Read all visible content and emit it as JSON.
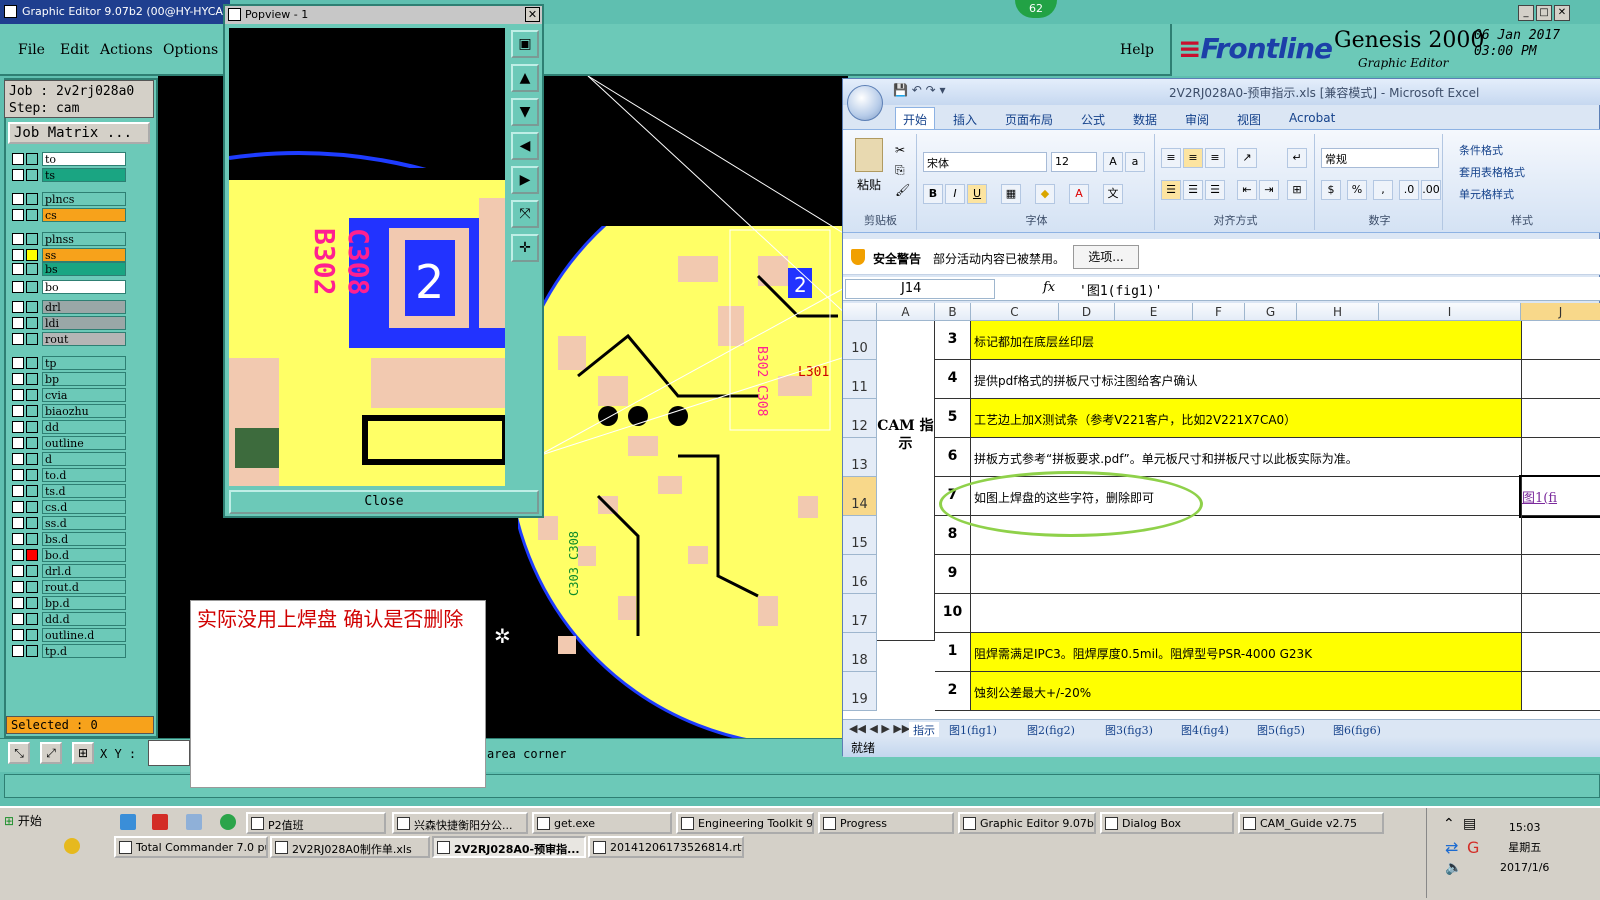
{
  "genesis": {
    "title": "Graphic Editor 9.07b2 (00@HY-HYCA",
    "menu": [
      "File",
      "Edit",
      "Actions",
      "Options"
    ],
    "help": "Help",
    "brand": {
      "logo": "Frontline",
      "product": "Genesis 2000",
      "subtitle": "Graphic Editor",
      "date": "06 Jan 2017",
      "time": "03:00 PM"
    },
    "badge": "62",
    "job": "Job : 2v2rj028a0",
    "step": "Step: cam",
    "job_matrix": "Job Matrix ...",
    "selected": "Selected : 0",
    "xy_label": "X Y :",
    "area_corner": "area corner",
    "layers": [
      {
        "name": "to",
        "color": "#ffffff",
        "swatch": ""
      },
      {
        "name": "ts",
        "color": "#1aa582",
        "swatch": ""
      },
      {
        "name": "plncs",
        "color": "#6cc9b8",
        "swatch": ""
      },
      {
        "name": "cs",
        "color": "#f7a21b",
        "swatch": ""
      },
      {
        "name": "plnss",
        "color": "#6cc9b8",
        "swatch": ""
      },
      {
        "name": "ss",
        "color": "#f7a21b",
        "swatch": "#ffff00"
      },
      {
        "name": "bs",
        "color": "#1aa582",
        "swatch": ""
      },
      {
        "name": "bo",
        "color": "#ffffff",
        "swatch": ""
      },
      {
        "name": "drl",
        "color": "#9aa7a7",
        "swatch": ""
      },
      {
        "name": "ldi",
        "color": "#9aa7a7",
        "swatch": ""
      },
      {
        "name": "rout",
        "color": "#b5b5b5",
        "swatch": ""
      },
      {
        "name": "tp",
        "color": "#6cc9b8",
        "swatch": ""
      },
      {
        "name": "bp",
        "color": "#6cc9b8",
        "swatch": ""
      },
      {
        "name": "cvia",
        "color": "#6cc9b8",
        "swatch": ""
      },
      {
        "name": "biaozhu",
        "color": "#6cc9b8",
        "swatch": ""
      },
      {
        "name": "dd",
        "color": "#6cc9b8",
        "swatch": ""
      },
      {
        "name": "outline",
        "color": "#6cc9b8",
        "swatch": ""
      },
      {
        "name": "d",
        "color": "#6cc9b8",
        "swatch": ""
      },
      {
        "name": "to.d",
        "color": "#6cc9b8",
        "swatch": ""
      },
      {
        "name": "ts.d",
        "color": "#6cc9b8",
        "swatch": ""
      },
      {
        "name": "cs.d",
        "color": "#6cc9b8",
        "swatch": ""
      },
      {
        "name": "ss.d",
        "color": "#6cc9b8",
        "swatch": ""
      },
      {
        "name": "bs.d",
        "color": "#6cc9b8",
        "swatch": ""
      },
      {
        "name": "bo.d",
        "color": "#6cc9b8",
        "swatch": "#ff0000"
      },
      {
        "name": "drl.d",
        "color": "#6cc9b8",
        "swatch": ""
      },
      {
        "name": "rout.d",
        "color": "#6cc9b8",
        "swatch": ""
      },
      {
        "name": "bp.d",
        "color": "#6cc9b8",
        "swatch": ""
      },
      {
        "name": "dd.d",
        "color": "#6cc9b8",
        "swatch": ""
      },
      {
        "name": "outline.d",
        "color": "#6cc9b8",
        "swatch": ""
      },
      {
        "name": "tp.d",
        "color": "#6cc9b8",
        "swatch": ""
      }
    ]
  },
  "popview": {
    "title": "Popview - 1",
    "close_label": "Close",
    "pcb_text": "2"
  },
  "note": {
    "text": "实际没用上焊盘  确认是否删除"
  },
  "excel": {
    "title": "2V2RJ028A0-预审指示.xls [兼容模式] - Microsoft Excel",
    "tabs": [
      "开始",
      "插入",
      "页面布局",
      "公式",
      "数据",
      "审阅",
      "视图",
      "Acrobat"
    ],
    "ribbon": {
      "paste": "粘贴",
      "clipboard": "剪贴板",
      "font_name": "宋体",
      "font_size": "12",
      "font_group": "字体",
      "align_group": "对齐方式",
      "number_format": "常规",
      "number_group": "数字",
      "styles_group": "样式",
      "cond_format": "条件格式",
      "table_format": "套用表格格式",
      "cell_style": "单元格样式"
    },
    "security": {
      "title": "安全警告",
      "message": "部分活动内容已被禁用。",
      "button": "选项..."
    },
    "name_box": "J14",
    "formula": "'图1(fig1)'",
    "columns": [
      "A",
      "B",
      "C",
      "D",
      "E",
      "F",
      "G",
      "H",
      "I",
      "J"
    ],
    "cam_label": "CAM 指示",
    "rows": [
      {
        "row": "10",
        "num": "3",
        "text": "标记都加在底层丝印层",
        "yellow": true,
        "link": ""
      },
      {
        "row": "11",
        "num": "4",
        "text": "提供pdf格式的拼板尺寸标注图给客户确认",
        "yellow": false,
        "link": ""
      },
      {
        "row": "12",
        "num": "5",
        "text": "工艺边上加X测试条（参考V221客户，比如2V221X7CA0）",
        "yellow": true,
        "link": ""
      },
      {
        "row": "13",
        "num": "6",
        "text": "拼板方式参考“拼板要求.pdf”。单元板尺寸和拼板尺寸以此板实际为准。",
        "yellow": false,
        "link": ""
      },
      {
        "row": "14",
        "num": "7",
        "text": "如图上焊盘的这些字符，删除即可",
        "yellow": false,
        "link": "图1(fi"
      },
      {
        "row": "15",
        "num": "8",
        "text": "",
        "yellow": false,
        "link": ""
      },
      {
        "row": "16",
        "num": "9",
        "text": "",
        "yellow": false,
        "link": ""
      },
      {
        "row": "17",
        "num": "10",
        "text": "",
        "yellow": false,
        "link": ""
      },
      {
        "row": "18",
        "num": "1",
        "text": "阻焊需满足IPC3。阻焊厚度0.5mil。阻焊型号PSR-4000 G23K",
        "yellow": true,
        "link": ""
      },
      {
        "row": "19",
        "num": "2",
        "text": "蚀刻公差最大+/-20%",
        "yellow": true,
        "link": ""
      }
    ],
    "sheets": [
      "指示",
      "图1(fig1)",
      "图2(fig2)",
      "图3(fig3)",
      "图4(fig4)",
      "图5(fig5)",
      "图6(fig6)"
    ],
    "status": "就绪"
  },
  "taskbar": {
    "start": "开始",
    "row1": [
      "P2值班",
      "兴森快捷衡阳分公...",
      "get.exe",
      "Engineering Toolkit 9....",
      "Progress",
      "Graphic Editor 9.07b2...",
      "Dialog Box",
      "CAM_Guide v2.75"
    ],
    "row2": [
      "Total Commander 7.0 pu...",
      "2V2RJ028A0制作单.xls",
      "2V2RJ028A0-预审指...",
      "20141206173526814.rtf..."
    ],
    "clock": {
      "time": "15:03",
      "day": "星期五",
      "date": "2017/1/6"
    }
  }
}
